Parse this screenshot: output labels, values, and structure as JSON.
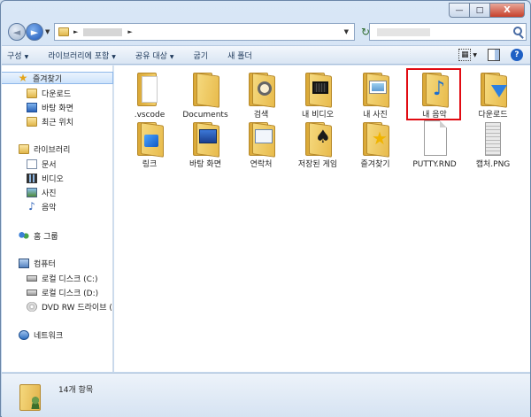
{
  "window": {
    "caption": {
      "minimize": "—",
      "maximize": "□",
      "close": "X"
    }
  },
  "address_bar": {
    "back_glyph": "◄",
    "forward_glyph": "►",
    "dropdown_glyph": "▼",
    "separator_glyph": "►",
    "refresh_glyph": "↻"
  },
  "toolbar": {
    "items": [
      {
        "label": "구성",
        "arrow": "▼"
      },
      {
        "label": "라이브러리에 포함",
        "arrow": "▼"
      },
      {
        "label": "공유 대상",
        "arrow": "▼"
      },
      {
        "label": "굽기",
        "arrow": ""
      },
      {
        "label": "새 폴더",
        "arrow": ""
      }
    ],
    "view_glyph": "▦",
    "view_arrow": "▼",
    "help_glyph": "?"
  },
  "nav_pane": {
    "favorites": {
      "label": "즐겨찾기",
      "icon": "star-icon"
    },
    "favorites_items": [
      {
        "label": "다운로드",
        "icon": "download-folder-icon"
      },
      {
        "label": "바탕 화면",
        "icon": "desktop-icon"
      },
      {
        "label": "최근 위치",
        "icon": "recent-places-icon"
      }
    ],
    "libraries": {
      "label": "라이브러리",
      "icon": "library-icon"
    },
    "library_items": [
      {
        "label": "문서",
        "icon": "documents-icon"
      },
      {
        "label": "비디오",
        "icon": "video-icon"
      },
      {
        "label": "사진",
        "icon": "pictures-icon"
      },
      {
        "label": "음악",
        "icon": "music-icon"
      }
    ],
    "homegroup": {
      "label": "홈 그룹",
      "icon": "homegroup-icon"
    },
    "computer": {
      "label": "컴퓨터",
      "icon": "computer-icon"
    },
    "computer_items": [
      {
        "label": "로컬 디스크 (C:)",
        "icon": "local-disk-icon"
      },
      {
        "label": "로컬 디스크 (D:)",
        "icon": "local-disk-icon"
      },
      {
        "label": "DVD RW 드라이브 (",
        "icon": "dvd-drive-icon"
      }
    ],
    "network": {
      "label": "네트워크",
      "icon": "network-icon"
    }
  },
  "files": [
    {
      "label": ".vscode"
    },
    {
      "label": "Documents"
    },
    {
      "label": "검색"
    },
    {
      "label": "내 비디오"
    },
    {
      "label": "내 사진"
    },
    {
      "label": "내 음악"
    },
    {
      "label": "다운로드"
    },
    {
      "label": "링크"
    },
    {
      "label": "바탕 화면"
    },
    {
      "label": "연락처"
    },
    {
      "label": "저장된 게임"
    },
    {
      "label": "즐겨찾기"
    },
    {
      "label": "PUTTY.RND"
    },
    {
      "label": "캡처.PNG"
    }
  ],
  "details": {
    "item_count": "14개 항목"
  },
  "colors": {
    "highlight": "#e10b12",
    "selection": "#cde3fb",
    "accent": "#1e5fc4"
  }
}
